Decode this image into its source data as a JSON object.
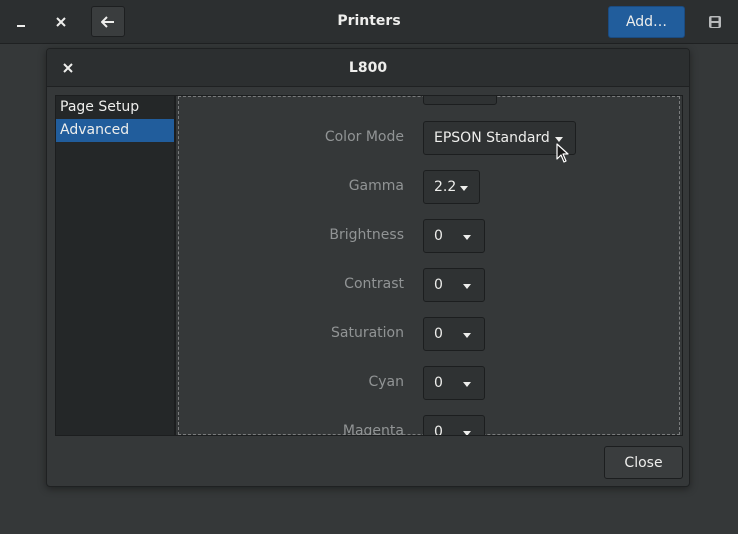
{
  "main_window": {
    "title": "Printers",
    "add_button_label": "Add…",
    "minimize_icon": "minimize-icon",
    "close_icon": "close-icon",
    "back_icon": "back-arrow-icon",
    "save_icon": "save-icon",
    "accent_color": "#215d9c"
  },
  "dialog": {
    "title": "L800",
    "close_button_label": "Close",
    "sidebar": {
      "items": [
        {
          "label": "Page Setup",
          "selected": false
        },
        {
          "label": "Advanced",
          "selected": true
        }
      ]
    },
    "settings": [
      {
        "label": "Color Mode",
        "value": "EPSON Standard"
      },
      {
        "label": "Gamma",
        "value": "2.2"
      },
      {
        "label": "Brightness",
        "value": "0"
      },
      {
        "label": "Contrast",
        "value": "0"
      },
      {
        "label": "Saturation",
        "value": "0"
      },
      {
        "label": "Cyan",
        "value": "0"
      },
      {
        "label": "Magenta",
        "value": "0"
      }
    ]
  }
}
